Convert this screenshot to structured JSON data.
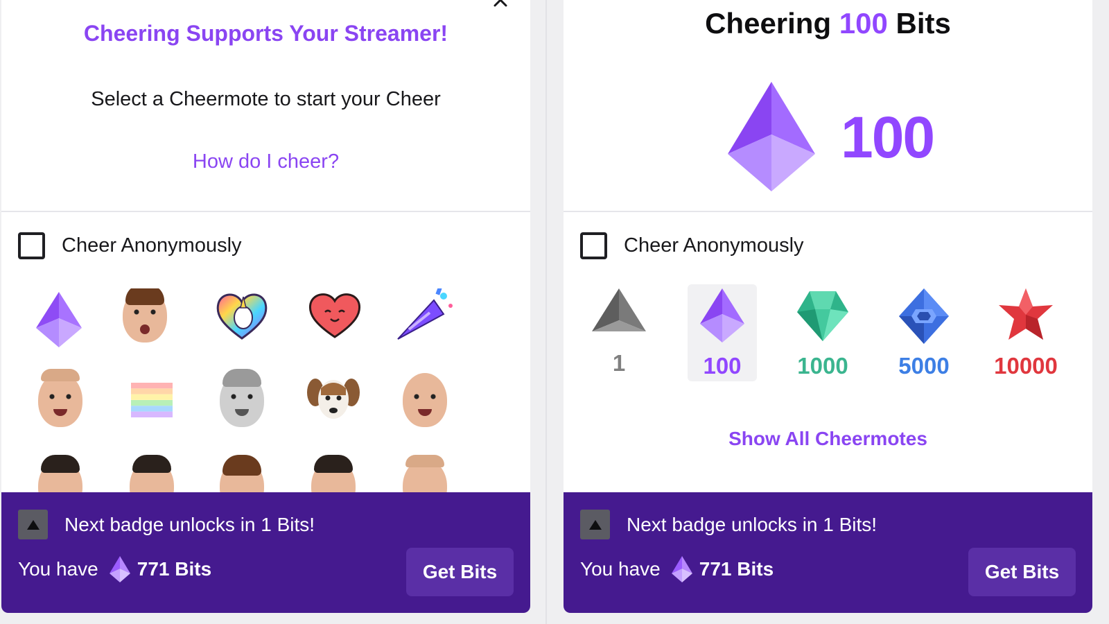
{
  "left_panel": {
    "title": "Cheering Supports Your Streamer!",
    "instruction": "Select a Cheermote to start your Cheer",
    "help_link": "How do I cheer?",
    "anonymous_label": "Cheer Anonymously",
    "anonymous_checked": false,
    "emote_icons": [
      "bits-gem-icon",
      "surprised-face-emote-icon",
      "unicorn-heart-emote-icon",
      "smiling-heart-emote-icon",
      "party-popper-emote-icon",
      "thumbs-up-man-emote-icon",
      "rainbow-flag-emote-icon",
      "grey-face-emote-icon",
      "dog-emote-icon",
      "waving-woman-emote-icon"
    ]
  },
  "right_panel": {
    "title_prefix": "Cheering",
    "title_amount": "100",
    "title_suffix": "Bits",
    "big_amount": "100",
    "anonymous_label": "Cheer Anonymously",
    "anonymous_checked": false,
    "tiers": [
      {
        "amount": "1",
        "color": "#808080",
        "icon": "grey-triangle-gem-icon"
      },
      {
        "amount": "100",
        "color": "#9147ff",
        "icon": "purple-gem-icon",
        "selected": true
      },
      {
        "amount": "1000",
        "color": "#3bb58f",
        "icon": "green-gem-icon"
      },
      {
        "amount": "5000",
        "color": "#3d7fe5",
        "icon": "blue-gem-icon"
      },
      {
        "amount": "10000",
        "color": "#e0373e",
        "icon": "red-star-gem-icon"
      }
    ],
    "show_all": "Show All Cheermotes"
  },
  "footer": {
    "badge_text": "Next badge unlocks in 1 Bits!",
    "you_have": "You have",
    "bits_balance": "771 Bits",
    "get_bits": "Get Bits"
  },
  "colors": {
    "accent": "#9147ff",
    "footer_bg": "#451a8f",
    "button_bg": "#5a2fa6"
  }
}
